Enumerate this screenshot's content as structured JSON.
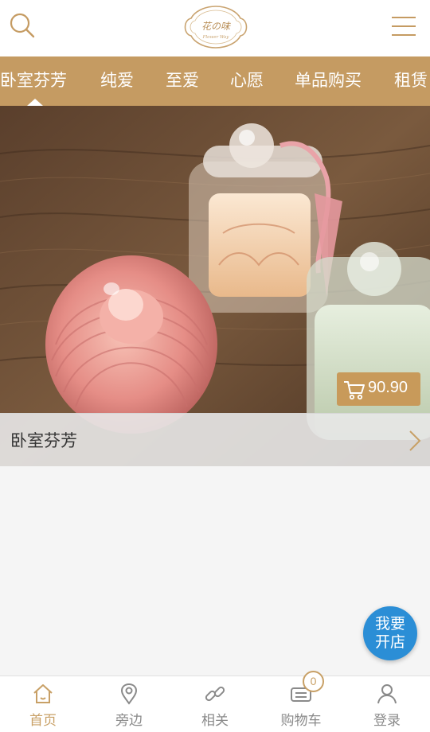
{
  "header": {
    "logo_text": "花の味",
    "logo_subtext": "Flower Way",
    "search_icon": "search-icon",
    "menu_icon": "menu-icon"
  },
  "tabs": [
    {
      "label": "卧室芬芳",
      "active": true
    },
    {
      "label": "纯爱",
      "active": false
    },
    {
      "label": "至爱",
      "active": false
    },
    {
      "label": "心愿",
      "active": false
    },
    {
      "label": "单品购买",
      "active": false
    },
    {
      "label": "租赁",
      "active": false
    }
  ],
  "hero": {
    "price": "90.90",
    "price_icon": "cart-icon",
    "caption": "卧室芬芳",
    "caption_icon": "chevron-right-icon"
  },
  "floating_button": {
    "line1": "我要",
    "line2": "开店"
  },
  "bottom_nav": [
    {
      "label": "首页",
      "icon": "home-icon",
      "active": true
    },
    {
      "label": "旁边",
      "icon": "location-pin-icon",
      "active": false
    },
    {
      "label": "相关",
      "icon": "link-icon",
      "active": false
    },
    {
      "label": "购物车",
      "icon": "cart-icon",
      "active": false
    },
    {
      "label": "登录",
      "icon": "user-icon",
      "active": false
    }
  ],
  "cart_count": "0",
  "colors": {
    "accent": "#c59b62",
    "nav_active": "#c8a066",
    "float_button": "#2b8ed6"
  }
}
